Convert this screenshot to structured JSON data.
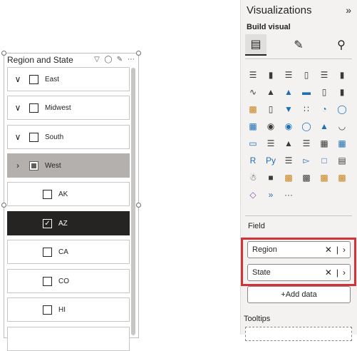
{
  "slicer": {
    "title": "Region and State",
    "tools": [
      "filter-icon",
      "eraser-icon",
      "focus-icon",
      "more-icon"
    ],
    "items": [
      {
        "label": "East",
        "level": "parent",
        "state": "unchecked",
        "expanded": false
      },
      {
        "label": "Midwest",
        "level": "parent",
        "state": "unchecked",
        "expanded": false
      },
      {
        "label": "South",
        "level": "parent",
        "state": "unchecked",
        "expanded": false
      },
      {
        "label": "West",
        "level": "parent",
        "state": "partial",
        "expanded": true
      },
      {
        "label": "AK",
        "level": "child",
        "state": "unchecked"
      },
      {
        "label": "AZ",
        "level": "child",
        "state": "checked"
      },
      {
        "label": "CA",
        "level": "child",
        "state": "unchecked"
      },
      {
        "label": "CO",
        "level": "child",
        "state": "unchecked"
      },
      {
        "label": "HI",
        "level": "child",
        "state": "unchecked"
      }
    ]
  },
  "pane": {
    "title": "Visualizations",
    "expand_glyph": "»",
    "subtitle": "Build visual",
    "modes": [
      "build-visual-icon",
      "format-visual-icon",
      "analytics-icon"
    ],
    "field_label": "Field",
    "fields": [
      {
        "name": "Region"
      },
      {
        "name": "State"
      }
    ],
    "add_data": "+Add data",
    "tooltips_label": "Tooltips",
    "more_visuals": "···",
    "accent_color": "#d13438"
  }
}
